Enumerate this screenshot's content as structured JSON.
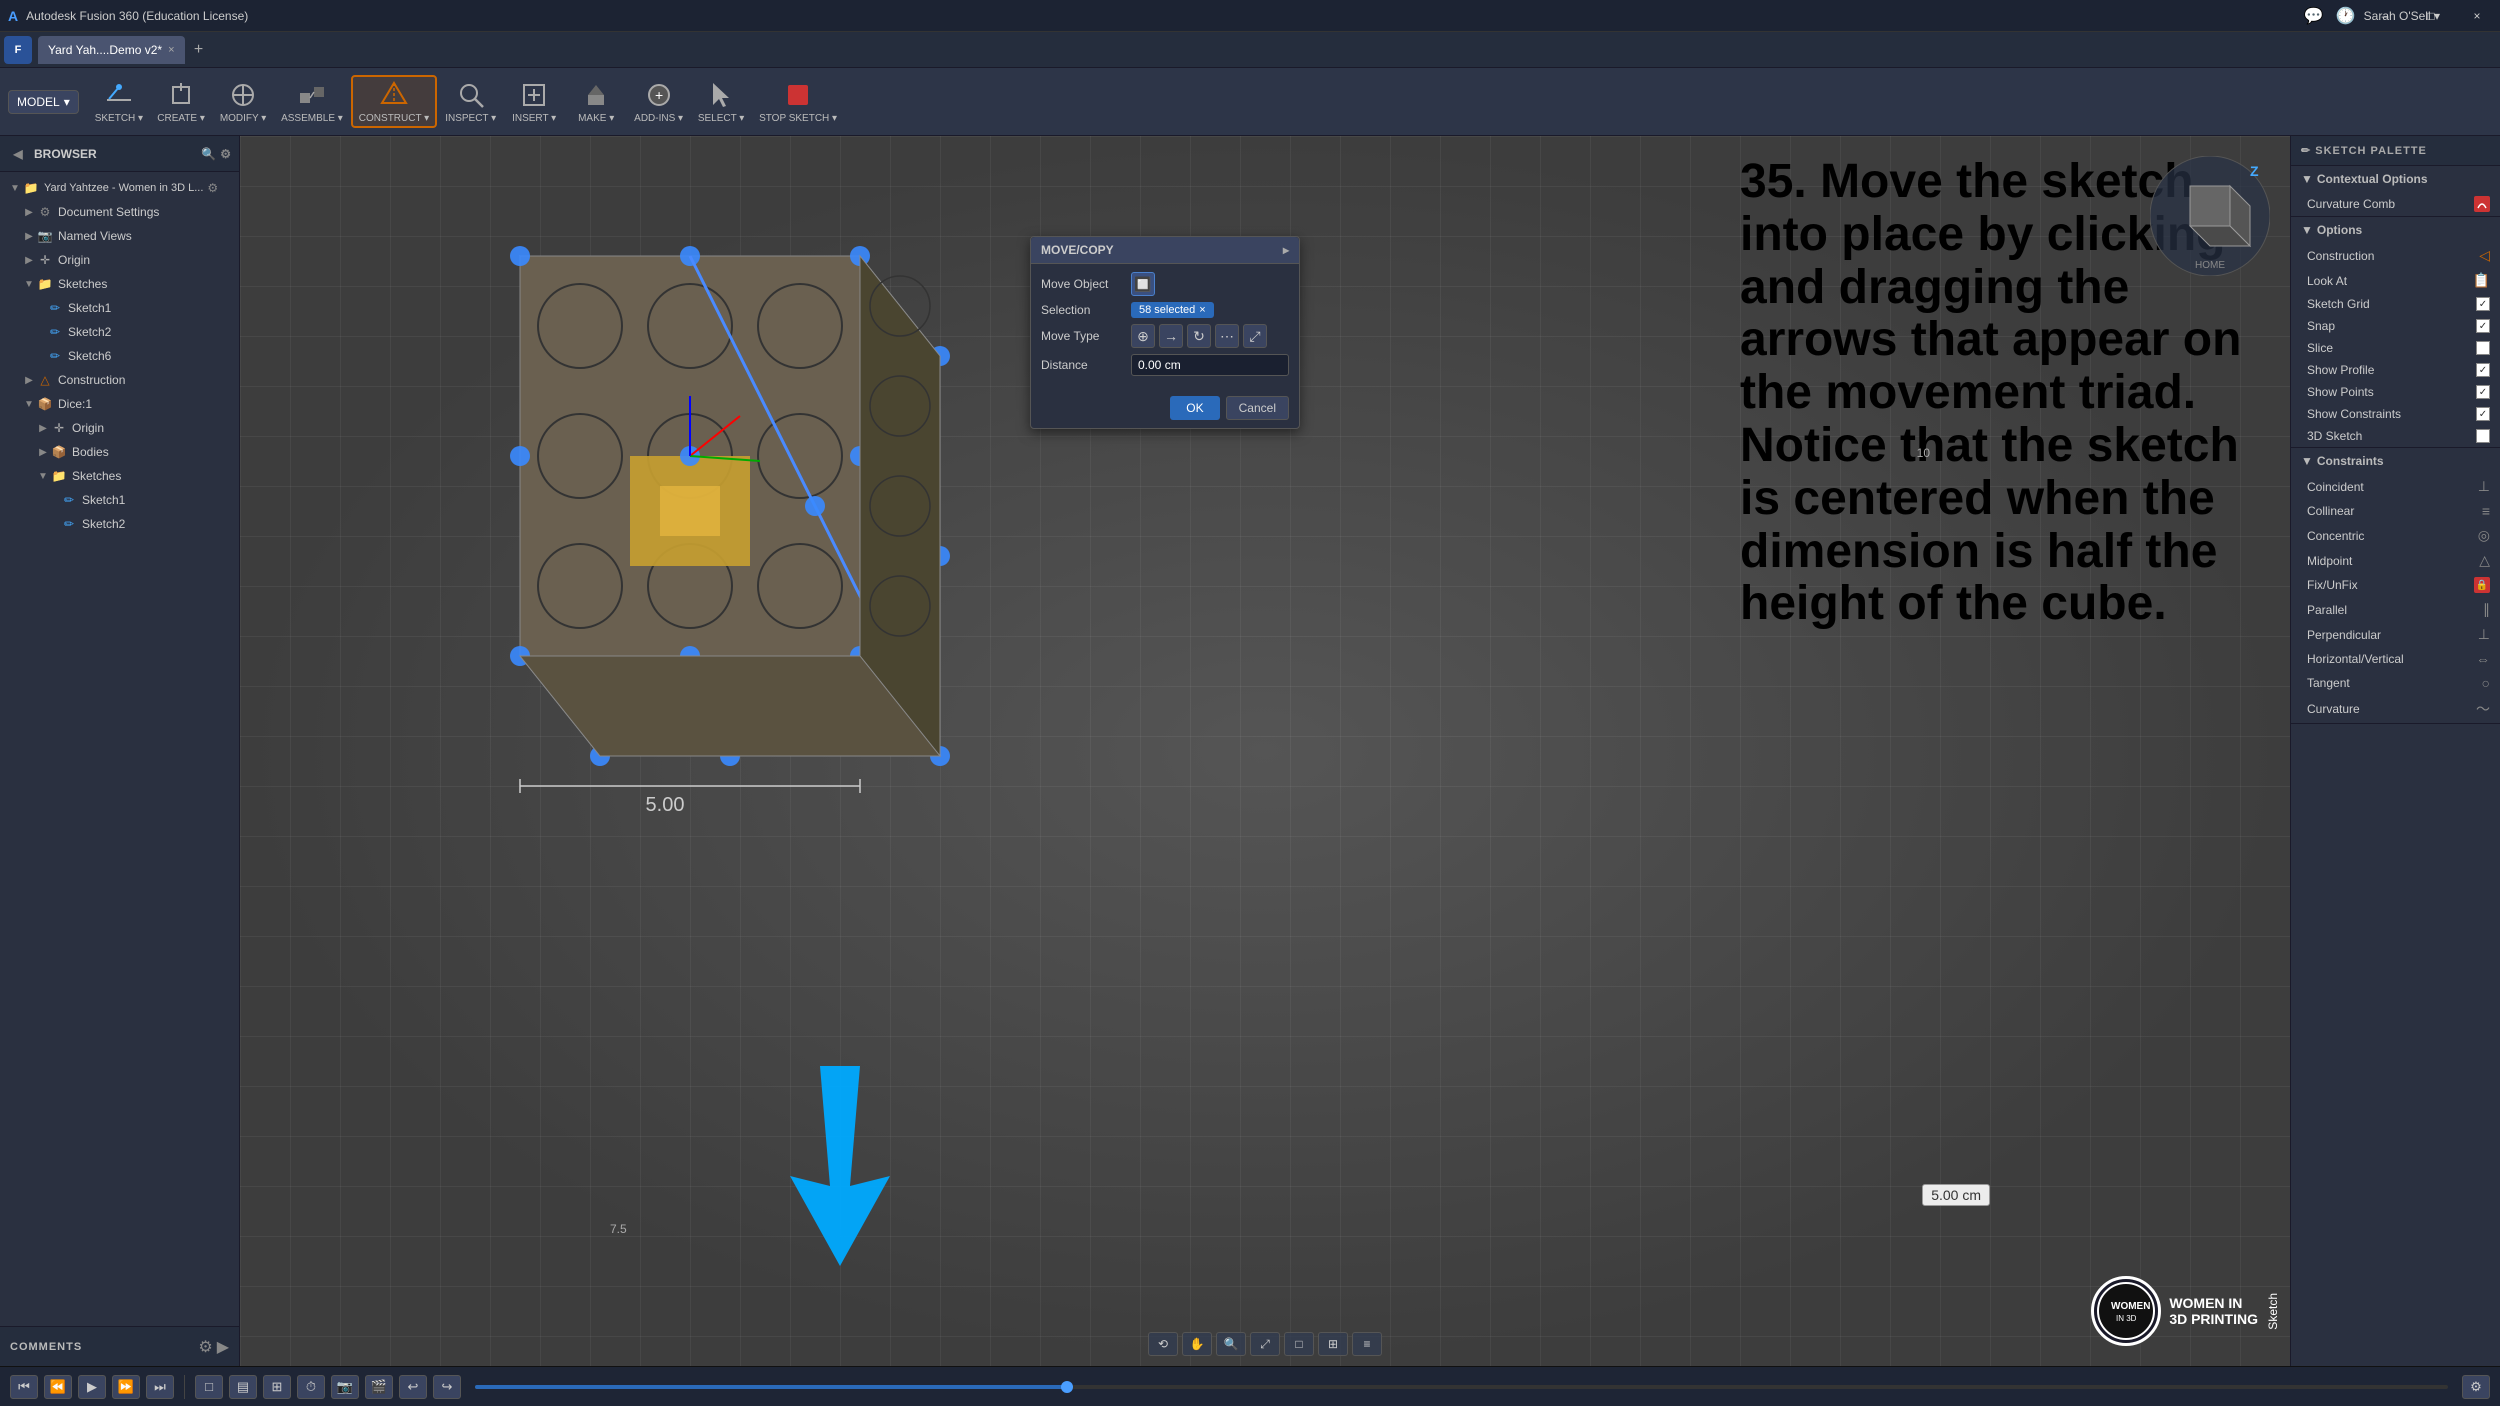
{
  "window": {
    "title": "Autodesk Fusion 360 (Education License)",
    "tab_label": "Yard Yah....Demo v2*",
    "close_icon": "×",
    "minimize_icon": "–",
    "maximize_icon": "□"
  },
  "toolbar": {
    "model_label": "MODEL",
    "groups": [
      {
        "id": "sketch",
        "label": "SKETCH ▾"
      },
      {
        "id": "create",
        "label": "CREATE ▾"
      },
      {
        "id": "modify",
        "label": "MODIFY ▾"
      },
      {
        "id": "assemble",
        "label": "ASSEMBLE ▾"
      },
      {
        "id": "construct",
        "label": "CONSTRUCT ▾"
      },
      {
        "id": "inspect",
        "label": "INSPECT ▾"
      },
      {
        "id": "insert",
        "label": "INSERT ▾"
      },
      {
        "id": "make",
        "label": "MAKE ▾"
      },
      {
        "id": "addins",
        "label": "ADD-INS ▾"
      },
      {
        "id": "select",
        "label": "SELECT ▾"
      },
      {
        "id": "stopsketch",
        "label": "STOP SKETCH ▾"
      }
    ]
  },
  "sidebar": {
    "header": "BROWSER",
    "items": [
      {
        "id": "root",
        "label": "Yard Yahtzee - Women in 3D L...",
        "level": 0,
        "type": "folder",
        "expanded": true
      },
      {
        "id": "doc-settings",
        "label": "Document Settings",
        "level": 1,
        "type": "settings"
      },
      {
        "id": "named-views",
        "label": "Named Views",
        "level": 1,
        "type": "folder"
      },
      {
        "id": "origin",
        "label": "Origin",
        "level": 1,
        "type": "origin"
      },
      {
        "id": "sketches",
        "label": "Sketches",
        "level": 1,
        "type": "folder",
        "expanded": true
      },
      {
        "id": "sketch1a",
        "label": "Sketch1",
        "level": 2,
        "type": "sketch"
      },
      {
        "id": "sketch2a",
        "label": "Sketch2",
        "level": 2,
        "type": "sketch"
      },
      {
        "id": "sketch6",
        "label": "Sketch6",
        "level": 2,
        "type": "sketch"
      },
      {
        "id": "construction",
        "label": "Construction",
        "level": 1,
        "type": "construction"
      },
      {
        "id": "dice1",
        "label": "Dice:1",
        "level": 1,
        "type": "component",
        "expanded": true
      },
      {
        "id": "origin2",
        "label": "Origin",
        "level": 2,
        "type": "origin"
      },
      {
        "id": "bodies",
        "label": "Bodies",
        "level": 2,
        "type": "folder"
      },
      {
        "id": "sketches2",
        "label": "Sketches",
        "level": 2,
        "type": "folder",
        "expanded": true
      },
      {
        "id": "sketch1b",
        "label": "Sketch1",
        "level": 3,
        "type": "sketch"
      },
      {
        "id": "sketch2b",
        "label": "Sketch2",
        "level": 3,
        "type": "sketch"
      }
    ]
  },
  "dialog": {
    "title": "MOVE/COPY",
    "move_object_label": "Move Object",
    "selection_label": "Selection",
    "selected_count": "58 selected",
    "move_type_label": "Move Type",
    "distance_label": "Distance",
    "distance_value": "0.00 cm",
    "ok_label": "OK",
    "cancel_label": "Cancel"
  },
  "instruction": {
    "text": "35. Move the sketch into place by clicking and dragging the arrows that appear on the movement triad. Notice that the sketch is centered when the dimension is half the height of the cube."
  },
  "right_panel": {
    "header": "SKETCH PALETTE",
    "sections": [
      {
        "id": "contextual-options",
        "title": "Contextual Options",
        "options": [
          {
            "label": "Curvature Comb",
            "type": "icon-red"
          }
        ]
      },
      {
        "id": "options",
        "title": "Options",
        "options": [
          {
            "label": "Construction",
            "type": "arrow-icon"
          },
          {
            "label": "Look At",
            "type": "calendar-icon"
          },
          {
            "label": "Sketch Grid",
            "type": "checkbox",
            "checked": true
          },
          {
            "label": "Snap",
            "type": "checkbox",
            "checked": true
          },
          {
            "label": "Slice",
            "type": "checkbox",
            "checked": false
          },
          {
            "label": "Show Profile",
            "type": "checkbox",
            "checked": true
          },
          {
            "label": "Show Points",
            "type": "checkbox",
            "checked": true
          },
          {
            "label": "Show Constraints",
            "type": "checkbox",
            "checked": true
          },
          {
            "label": "3D Sketch",
            "type": "checkbox",
            "checked": false
          }
        ]
      },
      {
        "id": "constraints",
        "title": "Constraints",
        "options": [
          {
            "label": "Coincident",
            "type": "constraint-symbol",
            "symbol": "⊥"
          },
          {
            "label": "Collinear",
            "type": "constraint-symbol",
            "symbol": "≡"
          },
          {
            "label": "Concentric",
            "type": "constraint-symbol",
            "symbol": "◎"
          },
          {
            "label": "Midpoint",
            "type": "constraint-symbol",
            "symbol": "△"
          },
          {
            "label": "Fix/UnFix",
            "type": "lock-icon"
          },
          {
            "label": "Parallel",
            "type": "constraint-symbol",
            "symbol": "∥"
          },
          {
            "label": "Perpendicular",
            "type": "constraint-symbol",
            "symbol": "⊥"
          },
          {
            "label": "Horizontal/Vertical",
            "type": "constraint-symbol",
            "symbol": "⇔"
          },
          {
            "label": "Tangent",
            "type": "constraint-symbol",
            "symbol": "○"
          },
          {
            "label": "Curvature",
            "type": "constraint-symbol",
            "symbol": "~"
          }
        ]
      }
    ]
  },
  "viewport": {
    "dim_label_1": "5.00",
    "dim_label_2": "5.00 cm",
    "grid_number_1": "7.5",
    "grid_number_2": "10"
  },
  "comments": {
    "label": "COMMENTS"
  },
  "bottombar": {
    "sketch_label": "Sketch",
    "settings_icon": "⚙"
  },
  "colors": {
    "accent_blue": "#2a6aba",
    "bg_dark": "#2a3040",
    "bg_darker": "#1c2333",
    "text_light": "#cccccc",
    "highlight": "#3a5080",
    "red": "#cc3333",
    "orange": "#cc6600"
  }
}
